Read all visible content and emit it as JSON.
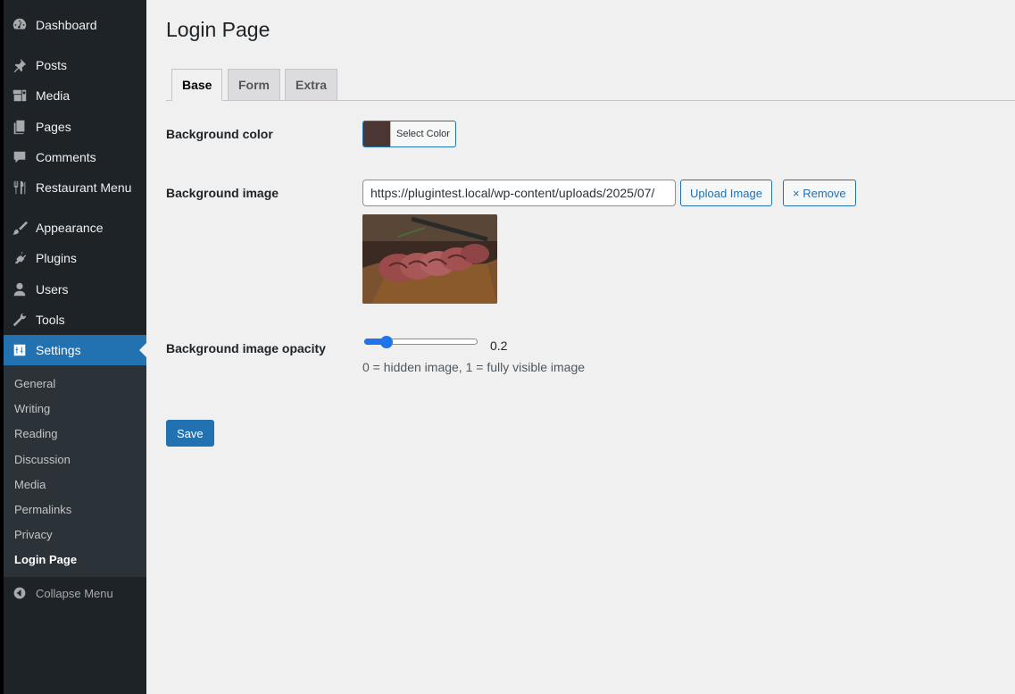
{
  "sidebar": {
    "items": [
      {
        "label": "Dashboard",
        "icon": "dashboard-icon"
      },
      {
        "label": "Posts",
        "icon": "pin-icon"
      },
      {
        "label": "Media",
        "icon": "media-icon"
      },
      {
        "label": "Pages",
        "icon": "pages-icon"
      },
      {
        "label": "Comments",
        "icon": "comment-icon"
      },
      {
        "label": "Restaurant Menu",
        "icon": "fork-knife-icon"
      },
      {
        "label": "Appearance",
        "icon": "brush-icon"
      },
      {
        "label": "Plugins",
        "icon": "plugin-icon"
      },
      {
        "label": "Users",
        "icon": "user-icon"
      },
      {
        "label": "Tools",
        "icon": "wrench-icon"
      },
      {
        "label": "Settings",
        "icon": "settings-icon",
        "active": true
      }
    ],
    "submenu": [
      "General",
      "Writing",
      "Reading",
      "Discussion",
      "Media",
      "Permalinks",
      "Privacy",
      "Login Page"
    ],
    "submenu_current": "Login Page",
    "collapse_label": "Collapse Menu"
  },
  "main": {
    "title": "Login Page",
    "tabs": [
      {
        "label": "Base",
        "active": true
      },
      {
        "label": "Form",
        "active": false
      },
      {
        "label": "Extra",
        "active": false
      }
    ],
    "fields": {
      "bg_color": {
        "label": "Background color",
        "button_label": "Select Color",
        "value": "#4b3634"
      },
      "bg_image": {
        "label": "Background image",
        "url": "https://plugintest.local/wp-content/uploads/2025/07/",
        "upload_label": "Upload Image",
        "remove_label": "× Remove"
      },
      "bg_opacity": {
        "label": "Background image opacity",
        "value": "0.2",
        "fraction": 0.2,
        "description": "0 = hidden image, 1 = fully visible image"
      }
    },
    "save_label": "Save"
  },
  "colors": {
    "sidebar_bg": "#1d2327",
    "accent": "#2271b1",
    "submenu_bg": "#2c3338",
    "page_bg": "#f0f0f1"
  }
}
